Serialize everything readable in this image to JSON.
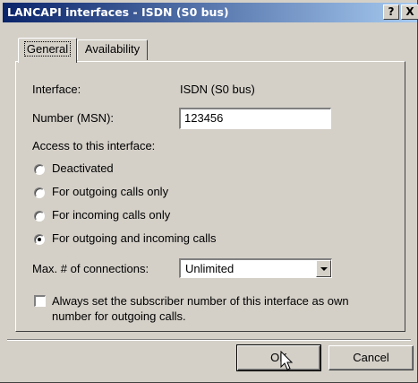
{
  "window": {
    "title": "LANCAPI interfaces - ISDN (S0 bus)",
    "help_label": "?",
    "close_label": "X"
  },
  "tabs": [
    {
      "label": "General",
      "selected": true
    },
    {
      "label": "Availability",
      "selected": false
    }
  ],
  "form": {
    "interface_label": "Interface:",
    "interface_value": "ISDN (S0 bus)",
    "number_label": "Number (MSN):",
    "number_value": "123456",
    "access_label": "Access to this interface:",
    "access_options": [
      {
        "label": "Deactivated",
        "selected": false
      },
      {
        "label": "For outgoing calls only",
        "selected": false
      },
      {
        "label": "For incoming calls only",
        "selected": false
      },
      {
        "label": "For outgoing and incoming calls",
        "selected": true
      }
    ],
    "max_connections_label": "Max. # of connections:",
    "max_connections_value": "Unlimited",
    "subscriber_checkbox_line1": "Always set the subscriber number of this interface as own",
    "subscriber_checkbox_line2": "number for outgoing calls.",
    "subscriber_checked": false
  },
  "buttons": {
    "ok_label": "OK",
    "cancel_label": "Cancel"
  }
}
